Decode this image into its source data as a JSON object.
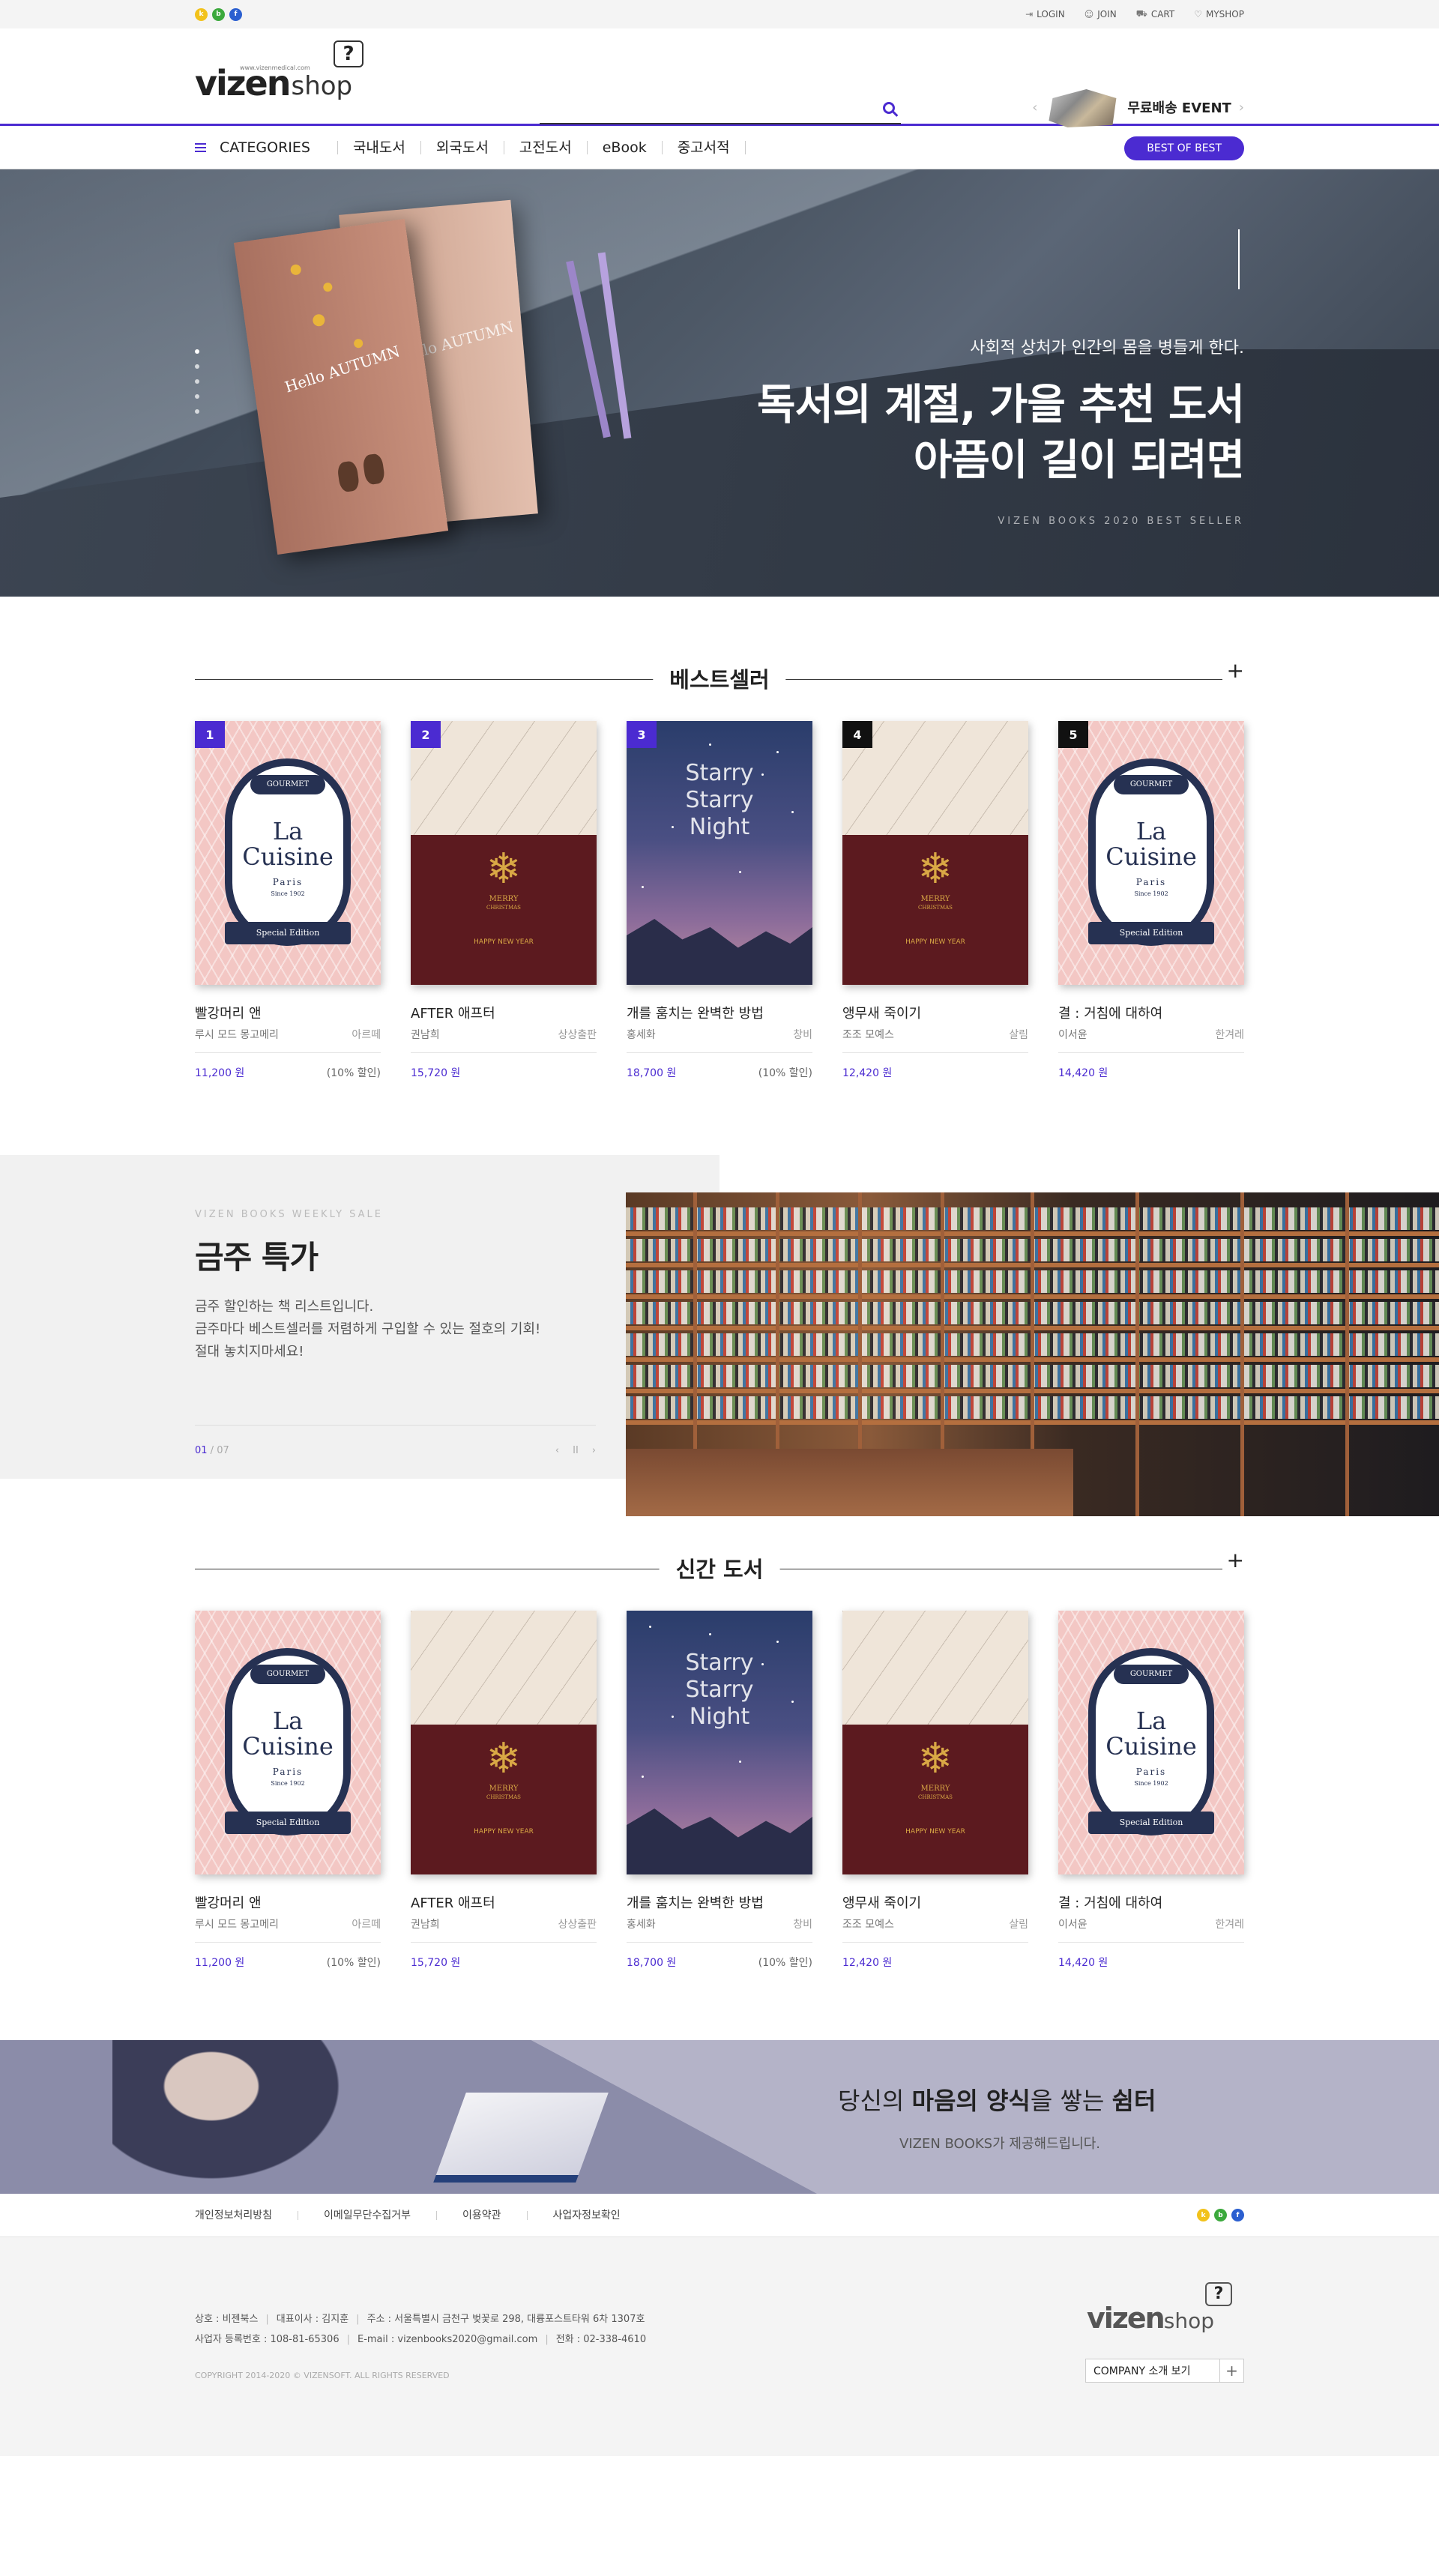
{
  "colors": {
    "accent": "#4b2bd1",
    "kakao": "#f2c21b",
    "blog": "#3ca93d",
    "facebook": "#2b5fd0"
  },
  "social": [
    {
      "name": "kakao",
      "label": "k"
    },
    {
      "name": "blog",
      "label": "b"
    },
    {
      "name": "facebook",
      "label": "f"
    }
  ],
  "util": {
    "login": "LOGIN",
    "join": "JOIN",
    "cart": "CART",
    "myshop": "MYSHOP"
  },
  "logo": {
    "brand": "vizen",
    "shop": "shop",
    "url": "www.vizenmedical.com",
    "mark": "?"
  },
  "search": {
    "placeholder": ""
  },
  "event": {
    "label": "무료배송 EVENT",
    "prev": "‹",
    "next": "›"
  },
  "nav": {
    "categories": "CATEGORIES",
    "items": [
      "국내도서",
      "외국도서",
      "고전도서",
      "eBook",
      "중고서적"
    ],
    "best": "BEST OF BEST"
  },
  "hero": {
    "sub": "사회적 상처가 인간의 몸을 병들게 한다.",
    "line1": "독서의 계절, 가을 추천 도서",
    "line2": "아픔이 길이 되려면",
    "en": "VIZEN BOOKS 2020 BEST SELLER",
    "book_a": "Hello AUTUMN",
    "book_b": "Hello AUTUMN"
  },
  "bestseller": {
    "title": "베스트셀러",
    "more": "+",
    "books": [
      {
        "rank": "1",
        "title": "빨강머리 앤",
        "author": "루시 모드 몽고메리",
        "publisher": "아르떼",
        "price": "11,200 원",
        "discount": "(10% 할인)",
        "cover": "pink"
      },
      {
        "rank": "2",
        "title": "AFTER 애프터",
        "author": "권남희",
        "publisher": "상상출판",
        "price": "15,720 원",
        "discount": "",
        "cover": "xmas"
      },
      {
        "rank": "3",
        "title": "개를 훔치는 완벽한 방법",
        "author": "홍세화",
        "publisher": "창비",
        "price": "18,700 원",
        "discount": "(10% 할인)",
        "cover": "night"
      },
      {
        "rank": "4",
        "title": "앵무새 죽이기",
        "author": "조조 모예스",
        "publisher": "살림",
        "price": "12,420 원",
        "discount": "",
        "cover": "xmas"
      },
      {
        "rank": "5",
        "title": "결 : 거침에 대하여",
        "author": "이서윤",
        "publisher": "한겨레",
        "price": "14,420 원",
        "discount": "",
        "cover": "pink"
      }
    ]
  },
  "covers": {
    "gourmet": "GOURMET",
    "la": "La",
    "cuisine": "Cuisine",
    "paris": "Paris",
    "since": "Since 1902",
    "special": "Special Edition",
    "merry": "MERRY",
    "christmas": "CHRISTMAS",
    "happy": "HAPPY NEW YEAR",
    "starry": "Starry",
    "night": "Night"
  },
  "weekly": {
    "en": "VIZEN BOOKS WEEKLY SALE",
    "title": "금주 특가",
    "desc1": "금주 할인하는 책 리스트입니다.",
    "desc2": "금주마다 베스트셀러를 저렴하게 구입할 수 있는 절호의 기회!",
    "desc3": "절대 놓치지마세요!",
    "page_cur": "01",
    "page_total": " / 07",
    "prev": "‹",
    "pause": "II",
    "next": "›"
  },
  "newbooks": {
    "title": "신간 도서",
    "more": "+",
    "books": [
      {
        "title": "빨강머리 앤",
        "author": "루시 모드 몽고메리",
        "publisher": "아르떼",
        "price": "11,200 원",
        "discount": "(10% 할인)",
        "cover": "pink"
      },
      {
        "title": "AFTER 애프터",
        "author": "권남희",
        "publisher": "상상출판",
        "price": "15,720 원",
        "discount": "",
        "cover": "xmas"
      },
      {
        "title": "개를 훔치는 완벽한 방법",
        "author": "홍세화",
        "publisher": "창비",
        "price": "18,700 원",
        "discount": "(10% 할인)",
        "cover": "night"
      },
      {
        "title": "앵무새 죽이기",
        "author": "조조 모예스",
        "publisher": "살림",
        "price": "12,420 원",
        "discount": "",
        "cover": "xmas"
      },
      {
        "title": "결 : 거침에 대하여",
        "author": "이서윤",
        "publisher": "한겨레",
        "price": "14,420 원",
        "discount": "",
        "cover": "pink"
      }
    ]
  },
  "promo": {
    "pre": "당신의 ",
    "b1": "마음의 양식",
    "mid": "을 쌓는 ",
    "b2": "쉼터",
    "sub": "VIZEN BOOKS가 제공해드립니다."
  },
  "footer": {
    "links": [
      "개인정보처리방침",
      "이메일무단수집거부",
      "이용약관",
      "사업자정보확인"
    ],
    "company": "상호 : 비젠북스",
    "ceo": "대표이사 : 김지훈",
    "address": "주소 : 서울특별시 금천구 벚꽃로 298, 대륭포스트타워 6차 1307호",
    "bizno": "사업자 등록번호 : 108-81-65306",
    "email": "E-mail : vizenbooks2020@gmail.com",
    "tel": "전화 : 02-338-4610",
    "copyright": "COPYRIGHT 2014-2020 © VIZENSOFT. ALL RIGHTS RESERVED",
    "company_btn": "COMPANY 소개 보기",
    "company_plus": "+"
  }
}
